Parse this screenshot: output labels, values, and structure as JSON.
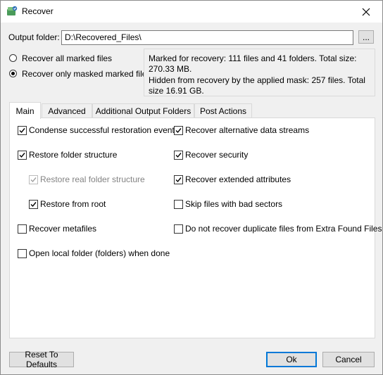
{
  "window": {
    "title": "Recover"
  },
  "output": {
    "label": "Output folder:",
    "value": "D:\\Recovered_Files\\",
    "browse_label": "..."
  },
  "mode": {
    "all_label": "Recover all marked files",
    "masked_label": "Recover only masked marked files",
    "selected": "masked"
  },
  "info": {
    "marked": "Marked for recovery: 111 files and 41 folders. Total size: 270.33 MB.",
    "hidden": "Hidden from recovery by the applied mask: 257 files. Total size 16.91 GB."
  },
  "tabs": [
    {
      "label": "Main",
      "active": true
    },
    {
      "label": "Advanced",
      "active": false
    },
    {
      "label": "Additional Output Folders",
      "active": false
    },
    {
      "label": "Post Actions",
      "active": false
    }
  ],
  "options_left": [
    {
      "label": "Condense successful restoration events",
      "checked": true,
      "enabled": true
    },
    {
      "label": "Restore folder structure",
      "checked": true,
      "enabled": true
    },
    {
      "label": "Restore real folder structure",
      "checked": true,
      "enabled": false
    },
    {
      "label": "Restore from root",
      "checked": true,
      "enabled": true
    },
    {
      "label": "Recover metafiles",
      "checked": false,
      "enabled": true
    },
    {
      "label": "Open local folder (folders) when done",
      "checked": false,
      "enabled": true
    }
  ],
  "options_right": [
    {
      "label": "Recover alternative data streams",
      "checked": true,
      "enabled": true
    },
    {
      "label": "Recover security",
      "checked": true,
      "enabled": true
    },
    {
      "label": "Recover extended attributes",
      "checked": true,
      "enabled": true
    },
    {
      "label": "Skip files with bad sectors",
      "checked": false,
      "enabled": true
    },
    {
      "label": "Do not recover duplicate files from Extra Found Files",
      "checked": false,
      "enabled": true
    }
  ],
  "buttons": {
    "reset": "Reset To Defaults",
    "ok": "Ok",
    "cancel": "Cancel"
  }
}
